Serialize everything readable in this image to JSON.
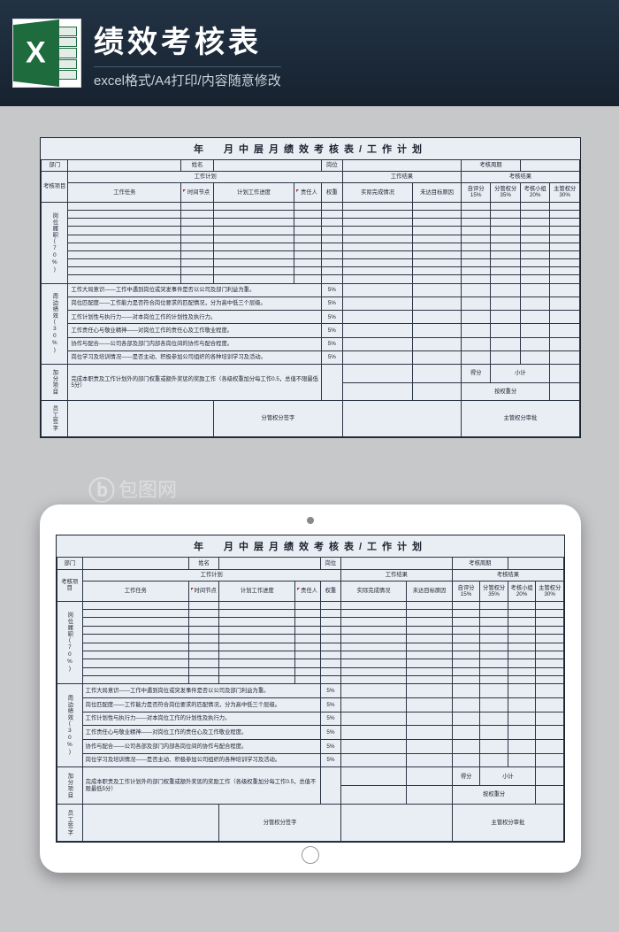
{
  "header": {
    "title": "绩效考核表",
    "subtitle": "excel格式/A4打印/内容随意修改",
    "icon_letter": "X"
  },
  "watermark": "包图网",
  "sheet": {
    "title": "年　月中层月绩效考核表/工作计划",
    "row_info": {
      "dept": "部门",
      "name": "姓名",
      "post": "岗位",
      "cycle": "考核周期"
    },
    "band": {
      "eval_item": "考核项目",
      "plan": "工作计划",
      "result": "工作结果",
      "score": "考核结果"
    },
    "cols": {
      "task": "工作任务",
      "time": "时间节点",
      "progress": "计划工作进度",
      "owner": "责任人",
      "weight": "权重",
      "actual": "实际完成情况",
      "miss": "未达目标原因",
      "self": "自评分15%",
      "mgr": "分管权分35%",
      "sub": "考核小组20%",
      "boss": "主管权分30%"
    },
    "side": {
      "duty": "岗位履职(70%)",
      "around": "周边绩效(30%)",
      "extra": "加分项目",
      "emp": "员工签字"
    },
    "around_rows": [
      {
        "t": "工作大局意识——工作中遇到岗位或突发事件是否以公司及部门利益为重。",
        "w": "5%"
      },
      {
        "t": "岗位匹配度——工作能力是否符合岗位要求的匹配情况，分为高中低三个层级。",
        "w": "5%"
      },
      {
        "t": "工作计划性与执行力——对本岗位工作的计划性及执行力。",
        "w": "5%"
      },
      {
        "t": "工作责任心与敬业精神——对岗位工作的责任心及工作敬业程度。",
        "w": "5%"
      },
      {
        "t": "协作与配合——公司各部及部门内部各岗位间的协作与配合程度。",
        "w": "5%"
      },
      {
        "t": "岗位学习及培训情况——是否主动、积极参加公司组织的各种培训学习及活动。",
        "w": "5%"
      }
    ],
    "extra_row": "完成本职责及工作计划外的部门权重或额外奖惩的奖励工作（各级权重加分每工作0.5，总值不限最低5分）",
    "foot": {
      "score_lbl": "得分",
      "subtotal": "小计",
      "final": "按权重分",
      "mgr_sign": "分管权分签字",
      "boss_sign": "主管权分审批"
    }
  }
}
